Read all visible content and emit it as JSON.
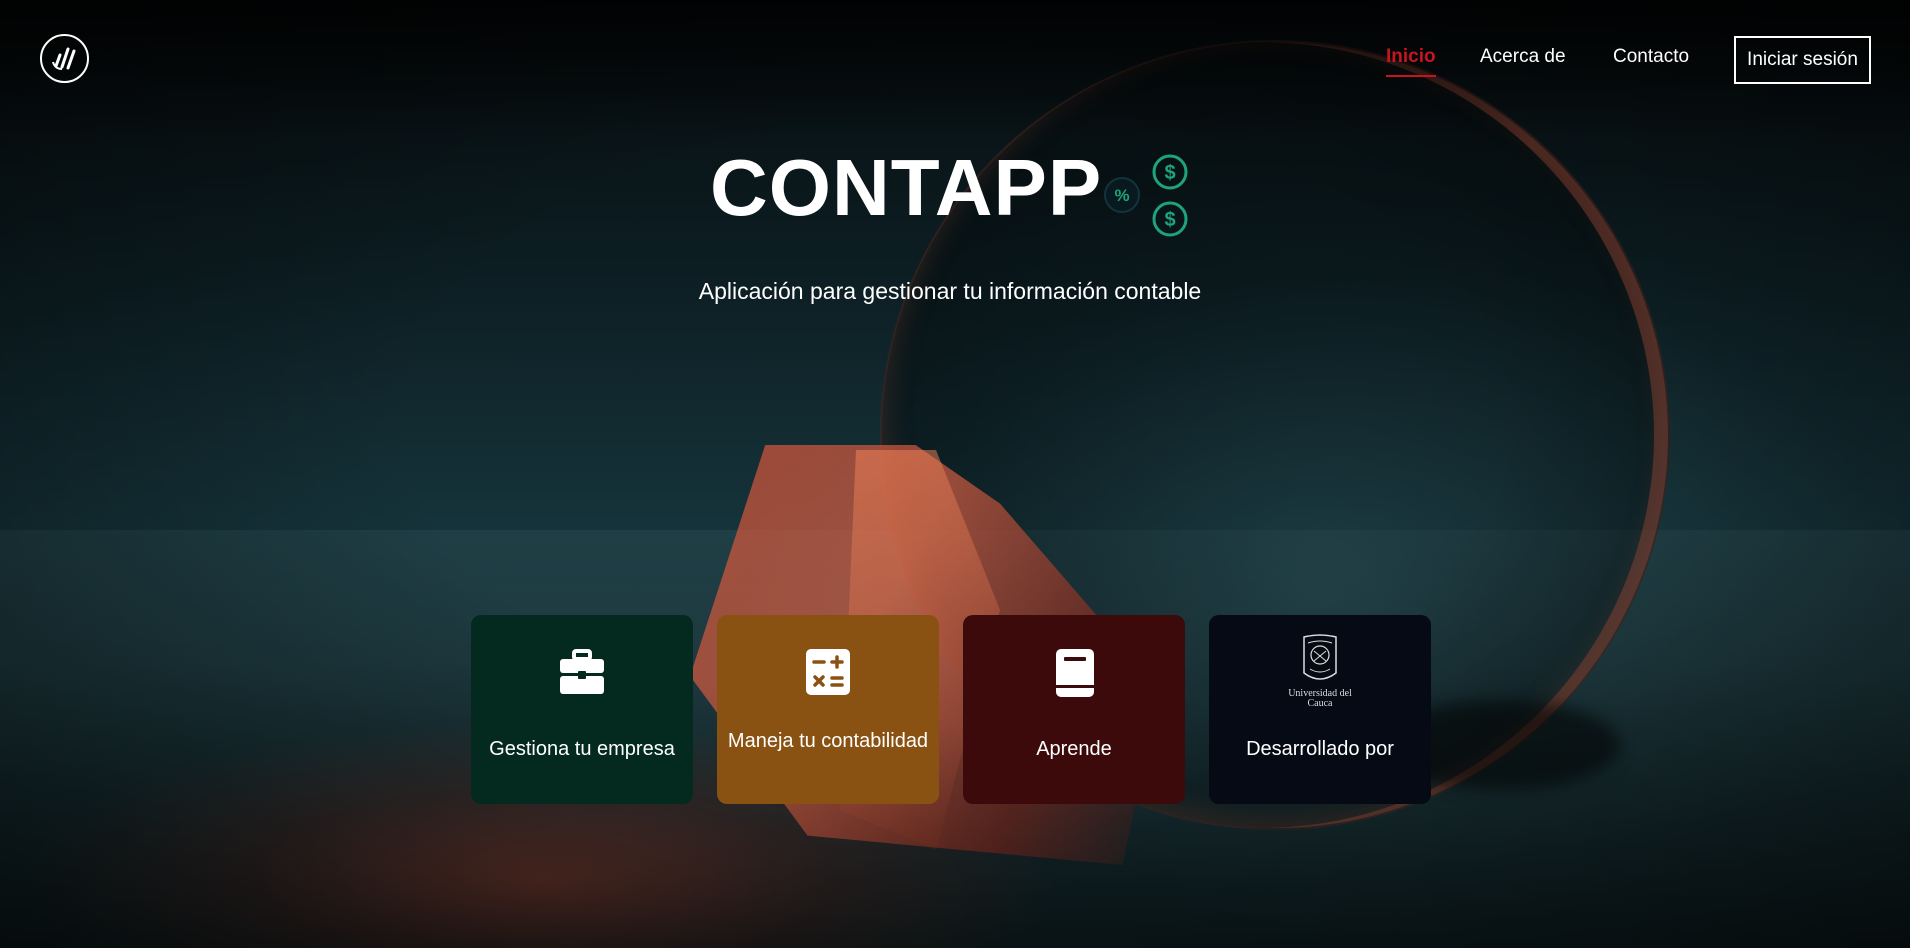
{
  "app": {
    "logo_icon": "contapp-logo-icon",
    "title": "CONTAPP",
    "title_icons": [
      "percent-coin-icon",
      "dollar-coin-icon",
      "dollar-coin-icon"
    ],
    "subtitle": "Aplicación para gestionar tu información contable"
  },
  "nav": {
    "items": [
      {
        "label": "Inicio",
        "active": true
      },
      {
        "label": "Acerca de",
        "active": false
      },
      {
        "label": "Contacto",
        "active": false
      }
    ],
    "login_label": "Iniciar sesión"
  },
  "cards": [
    {
      "label": "Gestiona tu empresa",
      "icon": "briefcase-icon",
      "color": "#042a1f"
    },
    {
      "label": "Maneja tu contabilidad",
      "icon": "calculator-icon",
      "color": "#8a5212"
    },
    {
      "label": "Aprende",
      "icon": "book-icon",
      "color": "#3c0a0a"
    },
    {
      "label": "Desarrollado por",
      "icon": "unicauca-seal-icon",
      "logo_text": "Universidad del Cauca",
      "color": "#050a14"
    }
  ],
  "colors": {
    "accent_red": "#c8141e",
    "coin_green": "#1fa37a"
  }
}
